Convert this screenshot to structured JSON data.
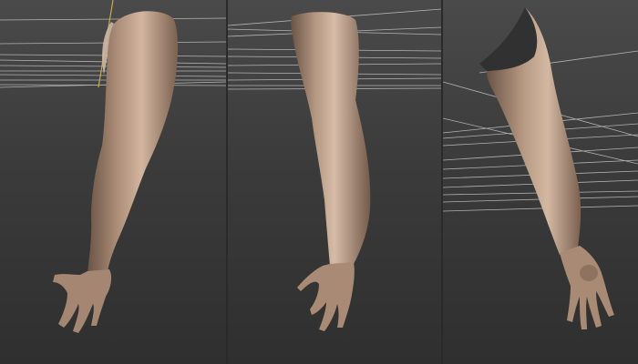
{
  "scene": {
    "panel_count": 3,
    "subject": "sculpted-arm-model",
    "colors": {
      "background_top": "#4a4a4a",
      "background_bottom": "#2f2f2f",
      "grid_line": "#d8d8d8",
      "skin_light": "#d4b8a2",
      "skin_mid": "#a98c77",
      "skin_dark": "#6b5446",
      "axis_line": "#c9a94a"
    }
  }
}
